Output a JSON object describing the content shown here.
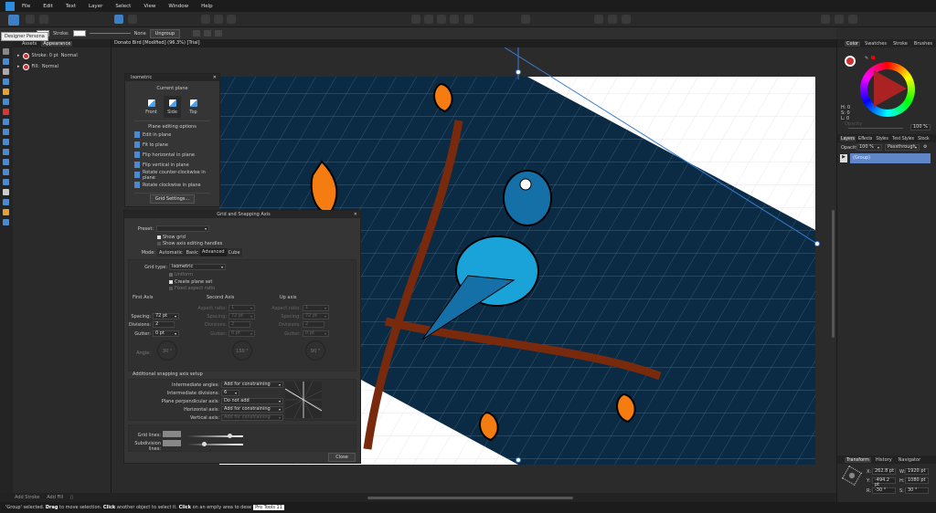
{
  "menu": [
    "File",
    "Edit",
    "Text",
    "Layer",
    "Select",
    "View",
    "Window",
    "Help"
  ],
  "tooltip": "Designer Persona",
  "context": {
    "stroke_label": "Stroke:",
    "none_label": "None",
    "ungroup": "Ungroup"
  },
  "left_panel": {
    "tabs": [
      "Assets",
      "Appearance"
    ],
    "stroke_row": "Stroke: 0 pt",
    "stroke_mode": "Normal",
    "fill_row": "Fill:",
    "fill_mode": "Normal",
    "add_stroke": "Add Stroke",
    "add_fill": "Add Fill"
  },
  "document_tab": "Donato Bird [Modified] (96.3%) [Trial]",
  "isometric": {
    "title": "Isometric",
    "current_plane": "Current plane",
    "planes": [
      "Front",
      "Side",
      "Top"
    ],
    "selected_plane": "Side",
    "options_title": "Plane editing options",
    "options": [
      "Edit in plane",
      "Fit to plane",
      "Flip horizontal in plane",
      "Flip vertical in plane",
      "Rotate counter-clockwise in plane",
      "Rotate clockwise in plane"
    ],
    "grid_settings": "Grid Settings..."
  },
  "grid_dialog": {
    "title": "Grid and Snapping Axis",
    "preset_label": "Preset:",
    "preset_value": "",
    "show_grid": "Show grid",
    "show_handles": "Show axis editing handles",
    "mode_label": "Mode:",
    "modes": [
      "Automatic",
      "Basic",
      "Advanced",
      "Cube"
    ],
    "active_mode": "Advanced",
    "grid_type_label": "Grid type:",
    "grid_type": "Isometric",
    "uniform": "Uniform",
    "create_plane_set": "Create plane set",
    "fixed_aspect": "Fixed aspect ratio",
    "axes": [
      {
        "title": "First Axis",
        "aspect": "",
        "spacing": "72 pt",
        "divisions": "2",
        "gutter": "0 pt",
        "angle": "30 °"
      },
      {
        "title": "Second Axis",
        "aspect": "1",
        "spacing": "72 pt",
        "divisions": "2",
        "gutter": "0 pt",
        "angle": "150 °"
      },
      {
        "title": "Up axis",
        "aspect": "1",
        "spacing": "72 pt",
        "divisions": "2",
        "gutter": "0 pt",
        "angle": "90 °"
      }
    ],
    "labels": {
      "aspect": "Aspect ratio:",
      "spacing": "Spacing:",
      "divisions": "Divisions:",
      "gutter": "Gutter:",
      "angle": "Angle:"
    },
    "snap_title": "Additional snapping axis setup",
    "snap": [
      {
        "label": "Intermediate angles:",
        "value": "Add for constraining"
      },
      {
        "label": "Intermediate divisions:",
        "value": "6"
      },
      {
        "label": "Plane perpendicular axis:",
        "value": "Do not add"
      },
      {
        "label": "Horizontal axis:",
        "value": "Add for constraining"
      },
      {
        "label": "Vertical axis:",
        "value": "Add for constraining"
      }
    ],
    "grid_lines": "Grid lines:",
    "subdivision_lines": "Subdivision lines:",
    "grid_lines_opacity": 0.78,
    "subdivision_opacity": 0.27,
    "close": "Close"
  },
  "right_panel": {
    "color_tabs": [
      "Color",
      "Swatches",
      "Stroke",
      "Brushes"
    ],
    "hsl": [
      "H: 0",
      "S: 0",
      "L: 0"
    ],
    "opacity_label": "Opacity",
    "opacity_value": "100 %",
    "layer_tabs": [
      "Layers",
      "Effects",
      "Styles",
      "Text Styles",
      "Stock"
    ],
    "layer_opacity_label": "Opacity:",
    "layer_opacity": "100 %",
    "blend": "Passthrough",
    "layer_name": "(Group)",
    "transform_tabs": [
      "Transform",
      "History",
      "Navigator"
    ],
    "transform": {
      "x_label": "X:",
      "x": "262.8 pt",
      "y_label": "Y:",
      "y": "-494.2 pt",
      "w_label": "W:",
      "w": "1920 pt",
      "h_label": "H:",
      "h": "1080 pt",
      "r_label": "R:",
      "r": "-30 °",
      "s_label": "S:",
      "s": "30 °"
    }
  },
  "status": {
    "pre": "'Group' selected.",
    "drag": "Drag",
    "t1": "to move selection.",
    "click1": "Click",
    "t2": "another object to select it.",
    "click2": "Click",
    "t3": "on an empty area to dese",
    "badge": "Pro Tools 11"
  },
  "colors": {
    "accent": "#3d7fc4",
    "canvas_band": "#0b2a44",
    "layer_sel": "#5f86c6"
  }
}
